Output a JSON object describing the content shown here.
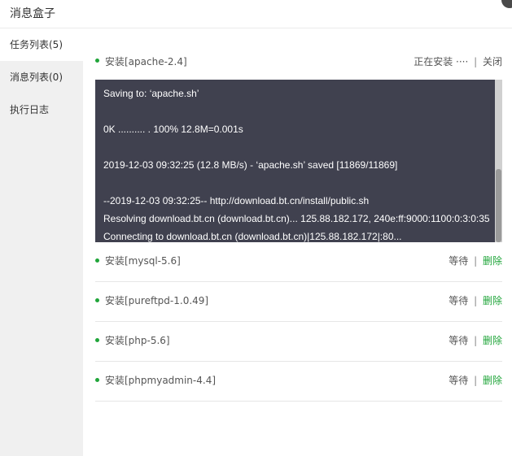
{
  "window": {
    "title": "消息盒子"
  },
  "sidebar": {
    "items": [
      {
        "label": "任务列表(5)",
        "active": true
      },
      {
        "label": "消息列表(0)",
        "active": false
      },
      {
        "label": "执行日志",
        "active": false
      }
    ]
  },
  "running_task": {
    "name": "安装[apache-2.4]",
    "status": "正在安装 ····",
    "separator": "|",
    "close_label": "关闭",
    "console_lines": [
      "Saving to: ‘apache.sh’",
      "",
      "0K .......... . 100% 12.8M=0.001s",
      "",
      "2019-12-03 09:32:25 (12.8 MB/s) - ‘apache.sh’ saved [11869/11869]",
      "",
      "--2019-12-03 09:32:25-- http://download.bt.cn/install/public.sh",
      "Resolving download.bt.cn (download.bt.cn)... 125.88.182.172, 240e:ff:9000:1100:0:3:0:35",
      "Connecting to download.bt.cn (download.bt.cn)|125.88.182.172|:80..."
    ]
  },
  "queued_tasks": [
    {
      "name": "安装[mysql-5.6]",
      "status": "等待",
      "separator": "|",
      "delete_label": "删除"
    },
    {
      "name": "安装[pureftpd-1.0.49]",
      "status": "等待",
      "separator": "|",
      "delete_label": "删除"
    },
    {
      "name": "安装[php-5.6]",
      "status": "等待",
      "separator": "|",
      "delete_label": "删除"
    },
    {
      "name": "安装[phpmyadmin-4.4]",
      "status": "等待",
      "separator": "|",
      "delete_label": "删除"
    }
  ],
  "colors": {
    "accent": "#20a53a",
    "console_bg": "#40414f"
  }
}
